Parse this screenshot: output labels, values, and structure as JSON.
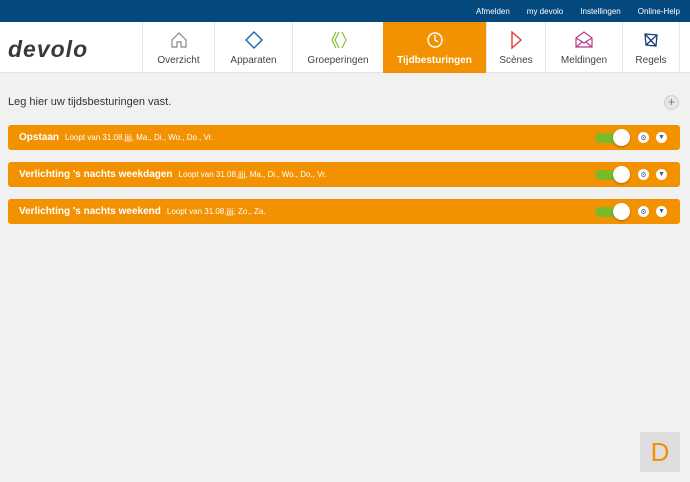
{
  "topbar": {
    "links": [
      "Afmelden",
      "my devolo",
      "Instellingen",
      "Online-Help"
    ]
  },
  "logo": "devolo",
  "nav": {
    "tabs": [
      {
        "label": "Overzicht",
        "icon": "home-icon"
      },
      {
        "label": "Apparaten",
        "icon": "diamond-icon"
      },
      {
        "label": "Groeperingen",
        "icon": "groups-icon"
      },
      {
        "label": "Tijdbesturingen",
        "icon": "clock-icon",
        "active": true
      },
      {
        "label": "Scènes",
        "icon": "play-icon"
      },
      {
        "label": "Meldingen",
        "icon": "envelope-icon"
      },
      {
        "label": "Regels",
        "icon": "rules-icon"
      }
    ]
  },
  "intro": "Leg hier uw tijdsbesturingen vast.",
  "add_label": "+",
  "schedules": [
    {
      "name": "Opstaan",
      "desc": "Loopt van 31.08.jjjj, Ma., Di., Wo., Do., Vr.",
      "enabled": true
    },
    {
      "name": "Verlichting 's nachts weekdagen",
      "desc": "Loopt van 31.08.jjjj, Ma., Di., Wo., Do., Vr.",
      "enabled": true
    },
    {
      "name": "Verlichting 's nachts weekend",
      "desc": "Loopt van 31.08.jjjj, Zo., Za.",
      "enabled": true
    }
  ],
  "corner_logo": "D",
  "colors": {
    "accent": "#f39200",
    "topbar": "#04497e",
    "toggle_on": "#7ab929"
  }
}
